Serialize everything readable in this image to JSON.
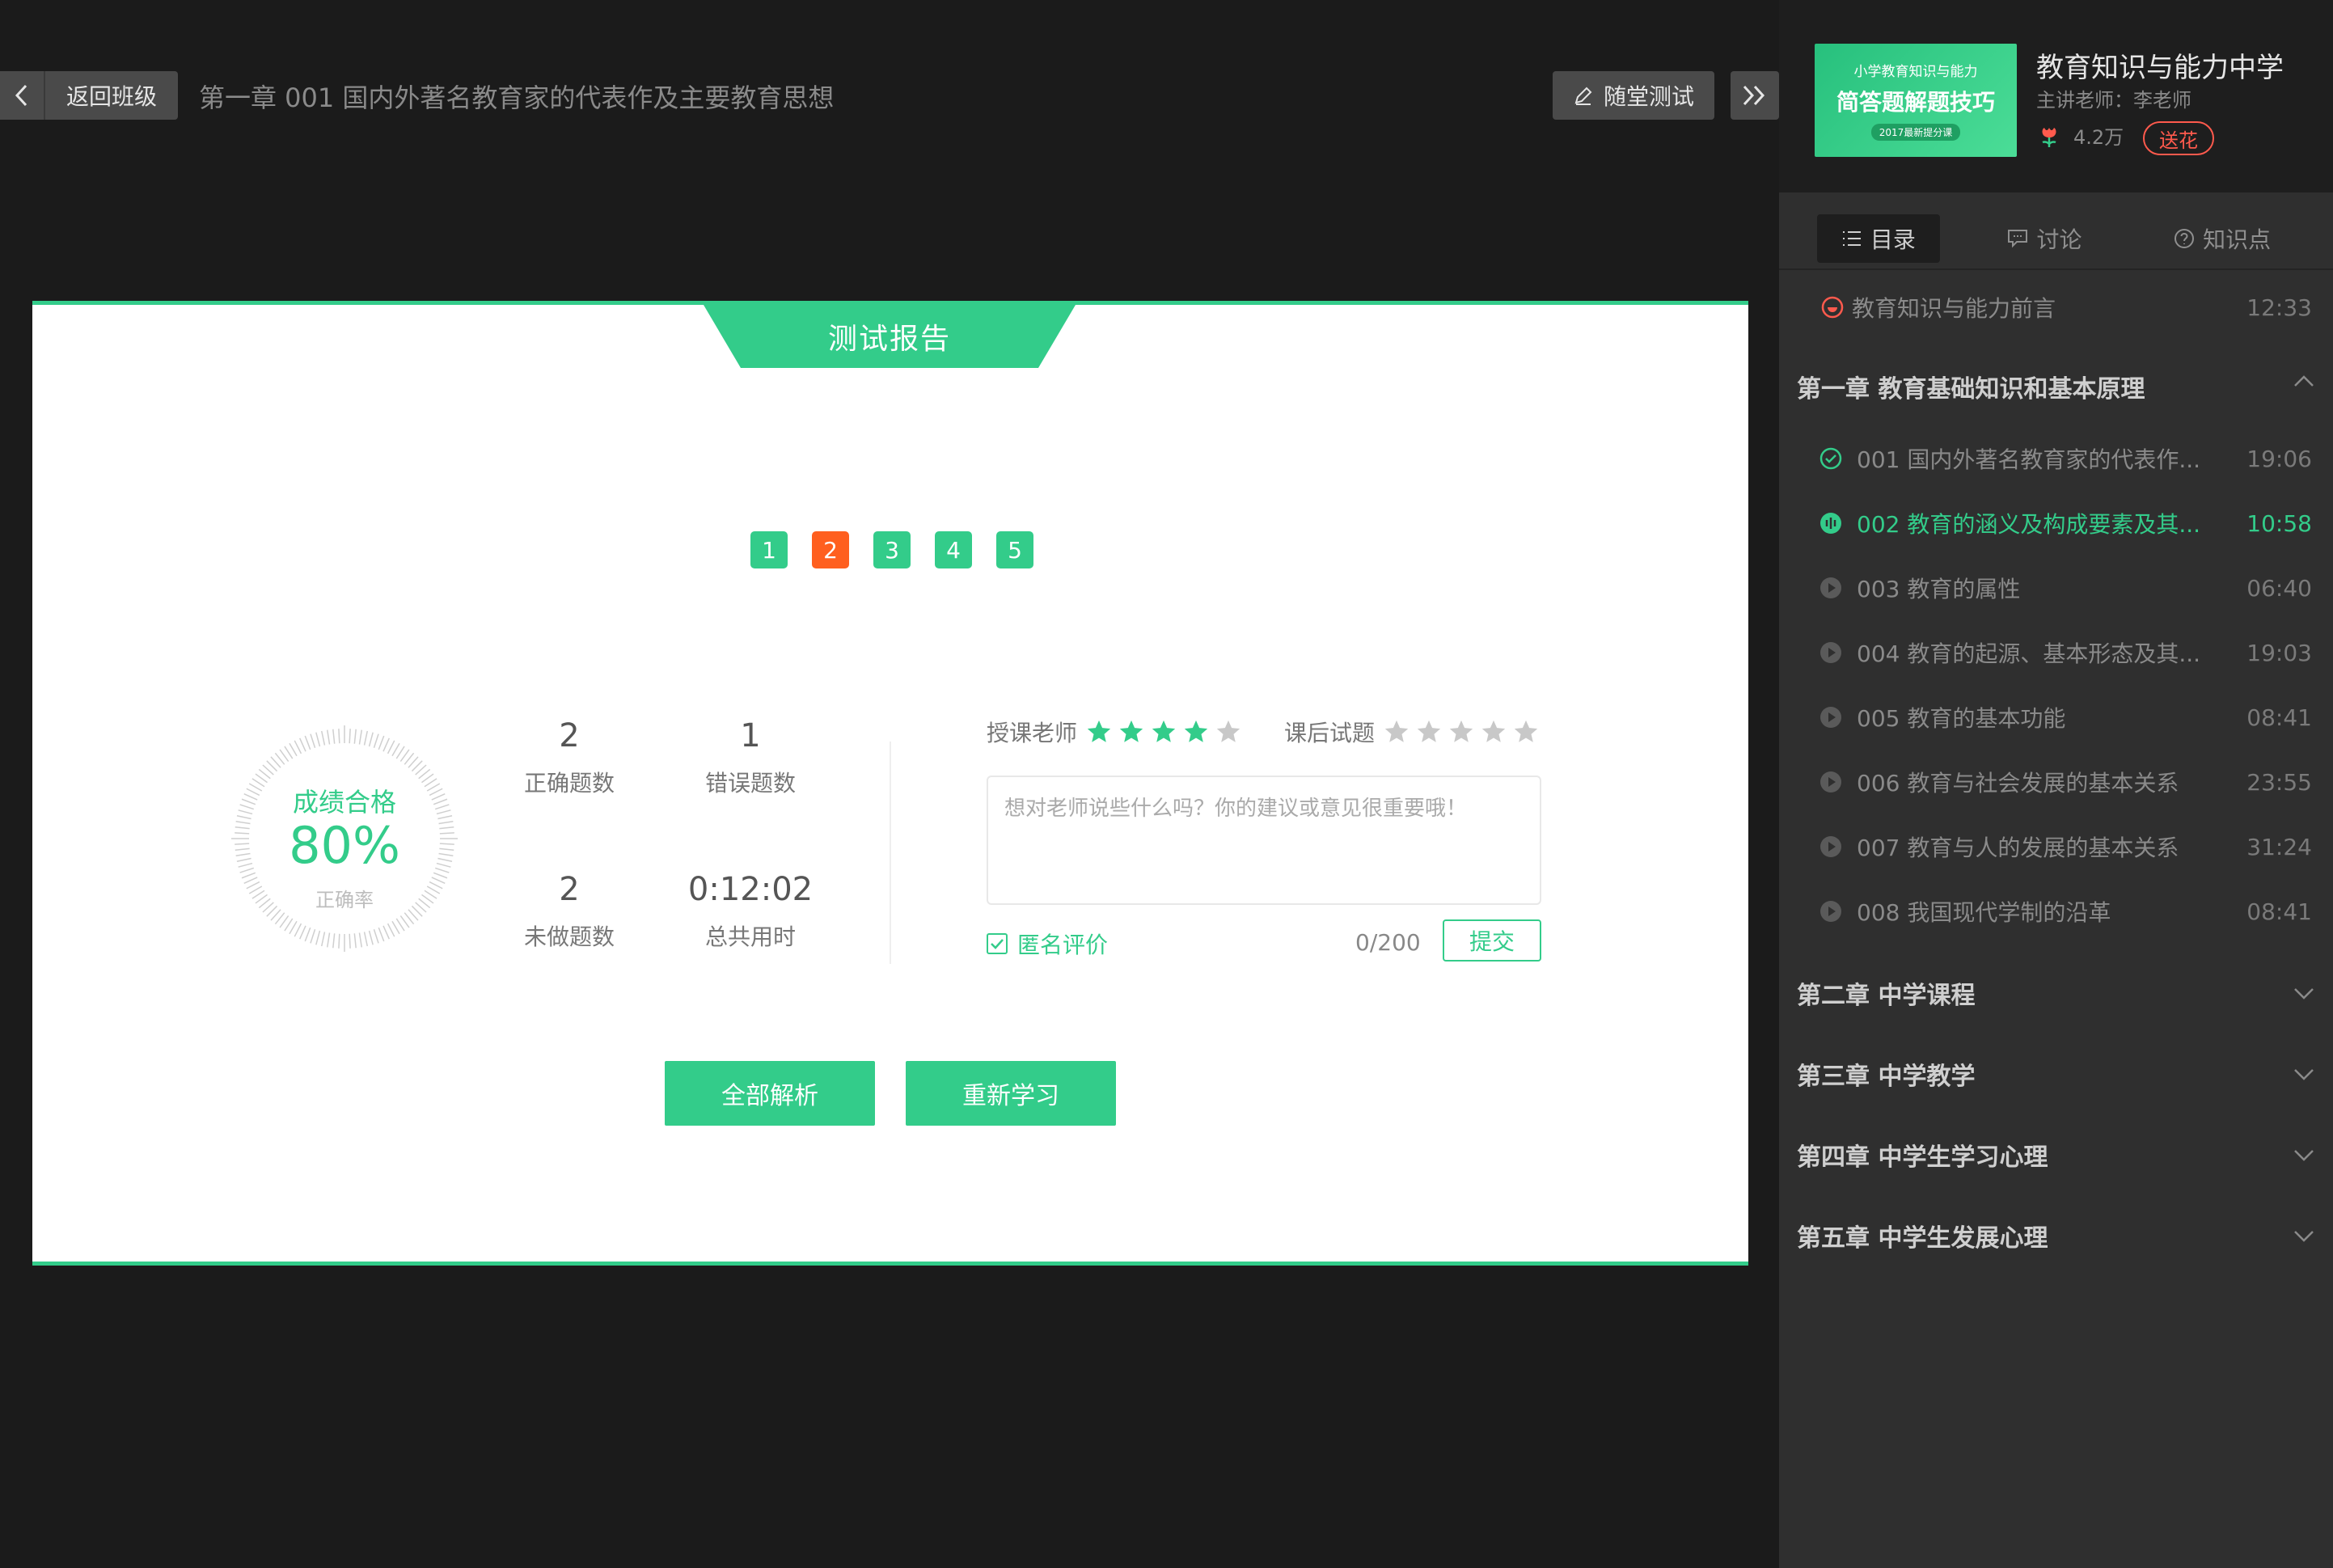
{
  "topbar": {
    "back_label": "返回班级",
    "lesson_title": "第一章  001 国内外著名教育家的代表作及主要教育思想",
    "quiz_label": "随堂测试"
  },
  "report": {
    "tab_title": "测试报告",
    "question_numbers": [
      {
        "n": "1",
        "status": "correct"
      },
      {
        "n": "2",
        "status": "wrong"
      },
      {
        "n": "3",
        "status": "correct"
      },
      {
        "n": "4",
        "status": "correct"
      },
      {
        "n": "5",
        "status": "correct"
      }
    ],
    "score_title": "成绩合格",
    "score_percent": "80%",
    "score_sub": "正确率",
    "stats": {
      "correct_value": "2",
      "correct_label": "正确题数",
      "wrong_value": "1",
      "wrong_label": "错误题数",
      "undone_value": "2",
      "undone_label": "未做题数",
      "time_value": "0:12:02",
      "time_label": "总共用时"
    },
    "rating": {
      "teacher_label": "授课老师",
      "teacher_stars": 4,
      "teacher_max": 5,
      "exercise_label": "课后试题",
      "exercise_stars": 0,
      "exercise_max": 5
    },
    "comment_placeholder": "想对老师说些什么吗？你的建议或意见很重要哦！",
    "anonymous_label": "匿名评价",
    "counter": "0/200",
    "submit_label": "提交",
    "analyze_all_label": "全部解析",
    "restudy_label": "重新学习",
    "accent": "#33cc8a",
    "wrong_color": "#ff5f1f"
  },
  "sidebar": {
    "thumb": {
      "line1": "小学教育知识与能力",
      "line2": "简答题解题技巧",
      "line3": "2017最新提分课"
    },
    "course_title": "教育知识与能力中学",
    "teacher": "主讲老师：李老师",
    "flowers": "4.2万",
    "gift_label": "送花",
    "tabs": [
      {
        "label": "目录",
        "icon": "list-icon",
        "active": true
      },
      {
        "label": "讨论",
        "icon": "comment-icon",
        "active": false
      },
      {
        "label": "知识点",
        "icon": "question-icon",
        "active": false
      }
    ],
    "intro": {
      "title": "教育知识与能力前言",
      "duration": "12:33"
    },
    "chapter1": {
      "title": "第一章  教育基础知识和基本原理",
      "lessons": [
        {
          "title": "001 国内外著名教育家的代表作...",
          "duration": "19:06",
          "state": "done"
        },
        {
          "title": "002 教育的涵义及构成要素及其...",
          "duration": "10:58",
          "state": "playing"
        },
        {
          "title": "003 教育的属性",
          "duration": "06:40",
          "state": "normal"
        },
        {
          "title": "004 教育的起源、基本形态及其...",
          "duration": "19:03",
          "state": "normal"
        },
        {
          "title": "005 教育的基本功能",
          "duration": "08:41",
          "state": "normal"
        },
        {
          "title": "006 教育与社会发展的基本关系",
          "duration": "23:55",
          "state": "normal"
        },
        {
          "title": "007 教育与人的发展的基本关系",
          "duration": "31:24",
          "state": "normal"
        },
        {
          "title": "008 我国现代学制的沿革",
          "duration": "08:41",
          "state": "normal"
        }
      ]
    },
    "chapters": [
      {
        "title": "第二章  中学课程"
      },
      {
        "title": "第三章  中学教学"
      },
      {
        "title": "第四章  中学生学习心理"
      },
      {
        "title": "第五章  中学生发展心理"
      }
    ]
  }
}
